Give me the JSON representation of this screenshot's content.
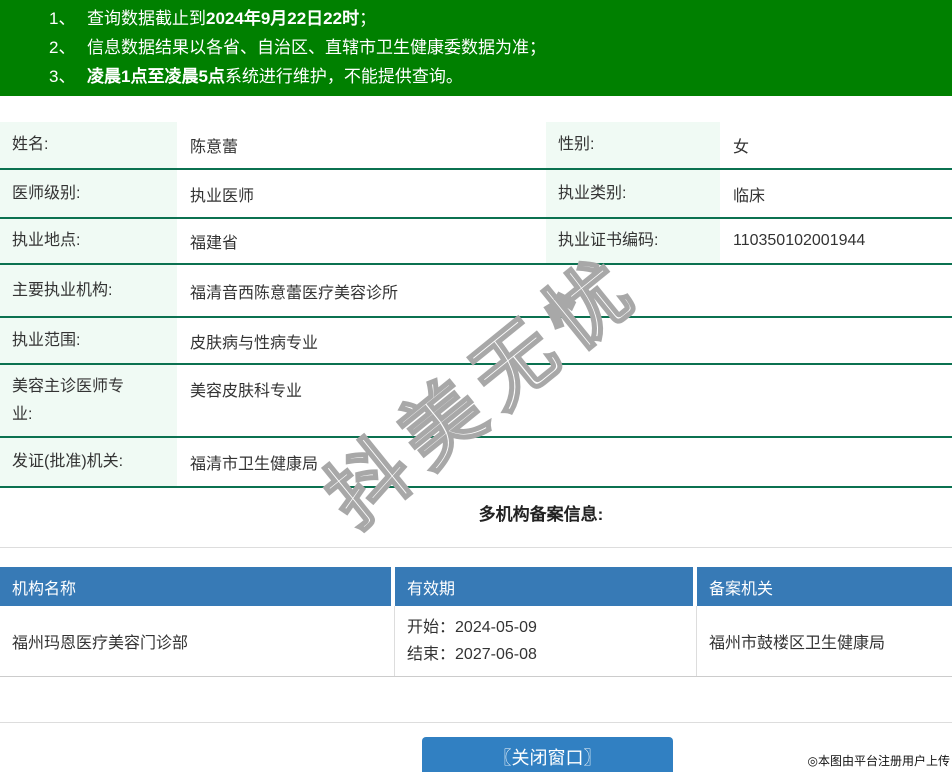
{
  "colors": {
    "notice_bg": "#008000",
    "row_line": "#0b7150",
    "label_bg": "#f0faf4",
    "table_header_bg": "#377ab6",
    "button_bg": "#3180c2"
  },
  "notice": {
    "items": [
      {
        "num": "1、",
        "pre": "查询数据截止到",
        "bold": "2024年9月22日22时",
        "post": "；"
      },
      {
        "num": "2、",
        "pre": "信息数据结果以各省、自治区、直辖市卫生健康委数据为准；",
        "bold": "",
        "post": ""
      },
      {
        "num": "3、",
        "pre": "",
        "bold": "凌晨1点至凌晨5点",
        "post": "系统进行维护，不能提供查询。"
      }
    ]
  },
  "info": {
    "row1": {
      "l1": "姓名:",
      "v1": "陈意蕾",
      "l2": "性别:",
      "v2": "女"
    },
    "row2": {
      "l1": "医师级别:",
      "v1": "执业医师",
      "l2": "执业类别:",
      "v2": "临床"
    },
    "row3": {
      "l1": "执业地点:",
      "v1": "福建省",
      "l2": "执业证书编码:",
      "v2": "110350102001944"
    },
    "row4": {
      "l1": "主要执业机构:",
      "v1": "福清音西陈意蕾医疗美容诊所"
    },
    "row5": {
      "l1": "执业范围:",
      "v1": "皮肤病与性病专业"
    },
    "row6": {
      "l1": "美容主诊医师专业:",
      "v1": "美容皮肤科专业"
    },
    "row7": {
      "l1": "发证(批准)机关:",
      "v1": "福清市卫生健康局"
    }
  },
  "filing": {
    "section_title": "多机构备案信息:",
    "headers": [
      "机构名称",
      "有效期",
      "备案机关"
    ],
    "row": {
      "org": "福州玛恩医疗美容门诊部",
      "start_label": "开始：",
      "start_date": "2024-05-09",
      "end_label": "结束：",
      "end_date": "2027-06-08",
      "authority": "福州市鼓楼区卫生健康局"
    }
  },
  "footer": {
    "close_button": "〖关闭窗口〗",
    "attribution": "◎本图由平台注册用户上传"
  },
  "watermark": {
    "text": "抖美无忧"
  }
}
